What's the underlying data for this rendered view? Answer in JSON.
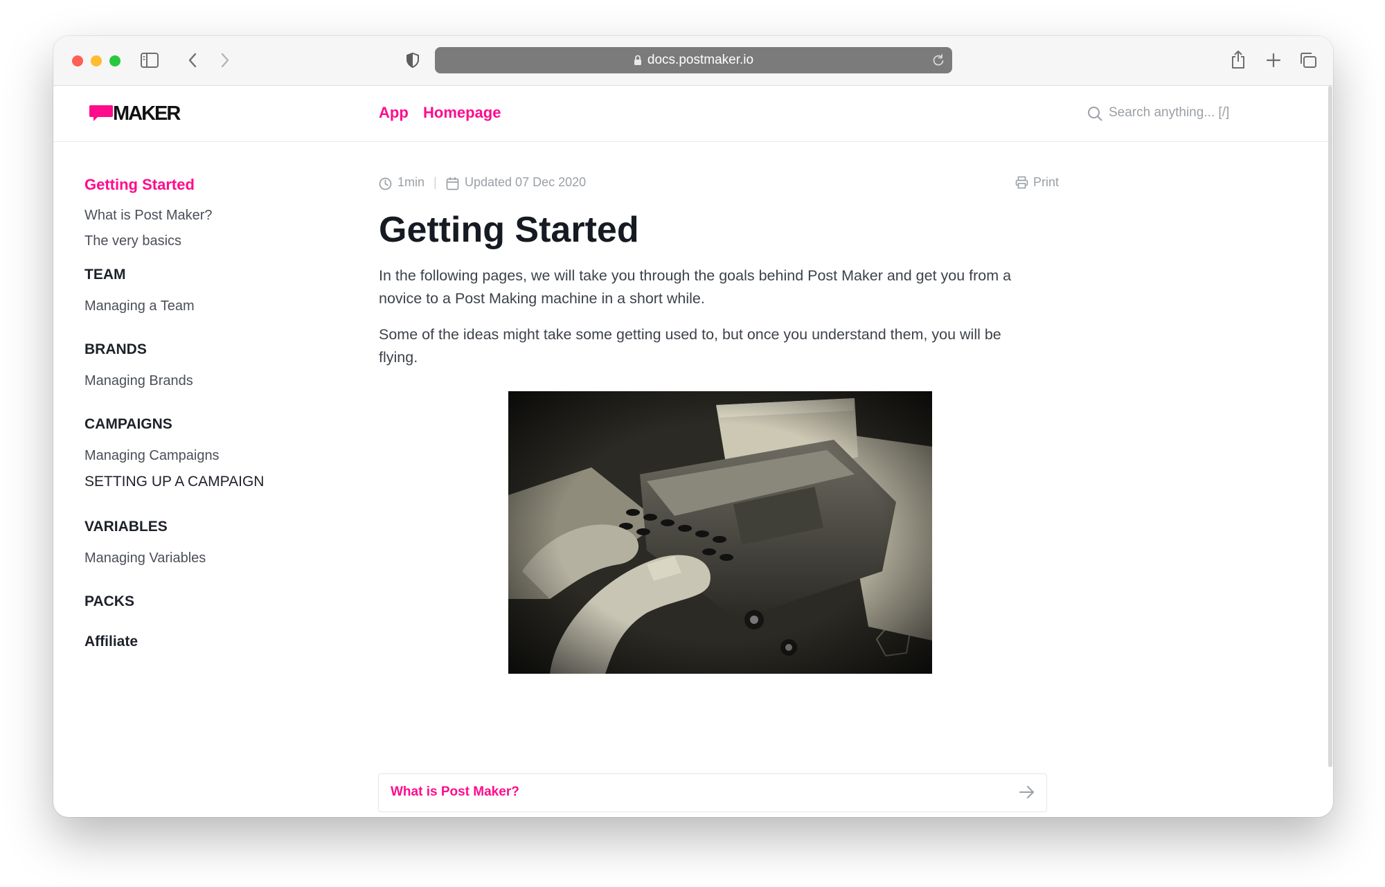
{
  "browser": {
    "url": "docs.postmaker.io"
  },
  "header": {
    "logo_text": "MAKER",
    "nav": [
      "App",
      "Homepage"
    ],
    "search_placeholder": "Search anything... [/]"
  },
  "sidebar": {
    "active": "Getting Started",
    "getting_started_links": [
      "What is Post Maker?",
      "The very basics"
    ],
    "sections": [
      {
        "heading": "TEAM",
        "links": [
          "Managing a Team"
        ]
      },
      {
        "heading": "BRANDS",
        "links": [
          "Managing Brands"
        ]
      },
      {
        "heading": "CAMPAIGNS",
        "links": [
          "Managing Campaigns"
        ],
        "extra": "SETTING UP A CAMPAIGN"
      },
      {
        "heading": "VARIABLES",
        "links": [
          "Managing Variables"
        ]
      },
      {
        "heading": "PACKS",
        "links": []
      },
      {
        "heading": "Affiliate",
        "links": []
      }
    ]
  },
  "article": {
    "read_time": "1min",
    "updated": "Updated 07 Dec 2020",
    "print_label": "Print",
    "title": "Getting Started",
    "paragraphs": [
      "In the following pages, we will take you through the goals behind Post Maker and get you from a novice to a Post Making machine in a short while.",
      "Some of the ideas might take some getting used to, but once you understand them, you will be flying."
    ],
    "next_link": "What is Post Maker?"
  },
  "colors": {
    "accent": "#ff0b8c",
    "text_dark": "#161a22",
    "text_muted": "#9aa0a6"
  },
  "icons": [
    "sidebar-toggle-icon",
    "back-icon",
    "forward-icon",
    "shield-icon",
    "lock-icon",
    "reload-icon",
    "share-icon",
    "new-tab-icon",
    "tabs-icon",
    "search-icon",
    "clock-icon",
    "calendar-icon",
    "printer-icon",
    "arrow-right-icon"
  ]
}
